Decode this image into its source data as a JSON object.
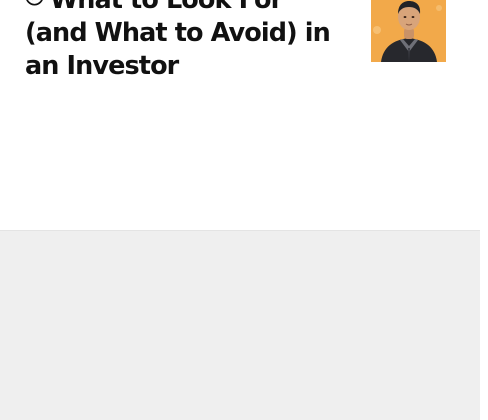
{
  "article": {
    "headline": "What to Look For (and What to Avoid) in an Investor",
    "play_icon": "play-circle-icon",
    "thumbnail": "author-portrait-image"
  },
  "colors": {
    "headline_text": "#111111",
    "thumbnail_background": "#f2a94a",
    "page_background": "#ffffff",
    "lower_panel": "#efefef"
  }
}
